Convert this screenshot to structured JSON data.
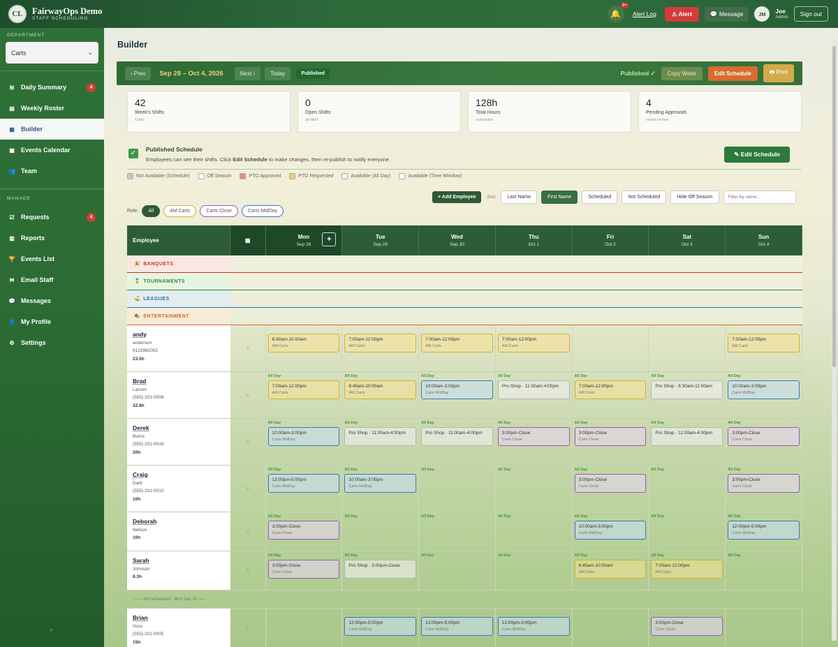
{
  "app": {
    "logo": "CL",
    "title": "FairwayOps Demo",
    "subtitle": "STAFF SCHEDULING"
  },
  "topbar": {
    "bell_badge": "9+",
    "alert_log": "Alert Log",
    "alert": "Alert",
    "message": "Message",
    "user_initials": "JM",
    "user_name": "Joe",
    "user_role": "Admin",
    "sign_out": "Sign out"
  },
  "sidebar": {
    "department_label": "DEPARTMENT",
    "department_value": "Carts",
    "manage_label": "MANAGE",
    "items": [
      {
        "label": "Daily Summary",
        "icon": "grid-icon",
        "badge": "4"
      },
      {
        "label": "Weekly Roster",
        "icon": "clipboard-icon",
        "badge": ""
      },
      {
        "label": "Builder",
        "icon": "calendar-icon",
        "badge": ""
      },
      {
        "label": "Events Calendar",
        "icon": "calendar-icon",
        "badge": ""
      },
      {
        "label": "Team",
        "icon": "team-icon",
        "badge": ""
      }
    ],
    "manage_items": [
      {
        "label": "Requests",
        "icon": "check-icon",
        "badge": "4"
      },
      {
        "label": "Reports",
        "icon": "chart-icon",
        "badge": ""
      },
      {
        "label": "Events List",
        "icon": "trophy-icon",
        "badge": ""
      },
      {
        "label": "Email Staff",
        "icon": "mail-icon",
        "badge": ""
      },
      {
        "label": "Messages",
        "icon": "chat-icon",
        "badge": ""
      },
      {
        "label": "My Profile",
        "icon": "user-icon",
        "badge": ""
      },
      {
        "label": "Settings",
        "icon": "gear-icon",
        "badge": ""
      }
    ]
  },
  "page": {
    "title": "Builder"
  },
  "toolbar": {
    "prev": "‹ Prev",
    "date_range": "Sep 28 – Oct 4, 2026",
    "next": "Next ›",
    "today": "Today",
    "published_pill": "Published",
    "published_status": "Published ✓",
    "copy_week": "Copy Week",
    "edit_schedule": "Edit Schedule",
    "print": "Print"
  },
  "stats": [
    {
      "value": "42",
      "label": "Week's Shifts",
      "sub": "Carts"
    },
    {
      "value": "0",
      "label": "Open Shifts",
      "sub": "all filled"
    },
    {
      "value": "128h",
      "label": "Total Hours",
      "sub": "scheduled"
    },
    {
      "value": "4",
      "label": "Pending Approvals",
      "sub": "needs review"
    }
  ],
  "publish_notice": {
    "title": "Published Schedule",
    "desc_pre": "Employees can see their shifts. Click ",
    "desc_bold": "Edit Schedule",
    "desc_post": " to make changes, then re-publish to notify everyone.",
    "button": "Edit Schedule"
  },
  "legend": [
    {
      "label": "Not Available (Schedule)",
      "color": "#c8c8c8"
    },
    {
      "label": "Off Season",
      "color": "#ffffff"
    },
    {
      "label": "PTO Approved",
      "color": "#e88a8a"
    },
    {
      "label": "PTO Requested",
      "color": "#f0c870"
    },
    {
      "label": "Available (All Day)",
      "color": "#f4f4f4"
    },
    {
      "label": "Available (Time Window)",
      "color": "#ffffff"
    }
  ],
  "controls": {
    "add_employee": "+ Add Employee",
    "sort_label": "Sort:",
    "last_name": "Last Name",
    "first_name": "First Name",
    "scheduled": "Scheduled",
    "not_scheduled": "Not Scheduled",
    "hide_off_season": "Hide Off Season",
    "filter_placeholder": "Filter by name..."
  },
  "roles": {
    "label": "Role:",
    "items": [
      "All",
      "AM Carts",
      "Carts Close",
      "Carts MidDay"
    ]
  },
  "grid": {
    "employee_header": "Employee",
    "days": [
      {
        "day": "Mon",
        "date": "Sep 28"
      },
      {
        "day": "Tue",
        "date": "Sep 29"
      },
      {
        "day": "Wed",
        "date": "Sep 30"
      },
      {
        "day": "Thu",
        "date": "Oct 1"
      },
      {
        "day": "Fri",
        "date": "Oct 2"
      },
      {
        "day": "Sat",
        "date": "Oct 3"
      },
      {
        "day": "Sun",
        "date": "Oct 4"
      }
    ],
    "categories": [
      {
        "label": "BANQUETS",
        "color": "#c0392b"
      },
      {
        "label": "TOURNAMENTS",
        "color": "#2e8b3a"
      },
      {
        "label": "LEAGUES",
        "color": "#2d6fa8"
      },
      {
        "label": "ENTERTAINMENT",
        "color": "#d06a2a"
      }
    ],
    "all_day": "All Day",
    "not_scheduled_sep": "—— Not scheduled · Mon Sep 28 ——"
  },
  "employees": [
    {
      "first": "andy",
      "last": "anderson",
      "phone": "6122982002",
      "hours": "23.5h",
      "allday": [
        0,
        0,
        0,
        0,
        0,
        0,
        0
      ],
      "shifts": [
        [
          "6:30am-10:00am",
          "AM Carts",
          "am"
        ],
        [
          "7:00am-12:00pm",
          "AM Carts",
          "am"
        ],
        [
          "7:00am-12:00pm",
          "AM Carts",
          "am"
        ],
        [
          "7:00am-12:00pm",
          "AM Carts",
          "am"
        ],
        null,
        null,
        [
          "7:00am-12:00pm",
          "AM Carts",
          "am"
        ]
      ]
    },
    {
      "first": "Brad",
      "last": "Larson",
      "phone": "(555) 201-0006",
      "hours": "32.8h",
      "allday": [
        1,
        1,
        1,
        1,
        1,
        1,
        1
      ],
      "shifts": [
        [
          "7:00am-12:00pm",
          "AM Carts",
          "am"
        ],
        [
          "6:45am-10:00am",
          "AM Carts",
          "am"
        ],
        [
          "10:00am-3:00pm",
          "Carts MidDay",
          "mid"
        ],
        [
          "Pro Shop · 11:00am-4:00pm",
          "",
          "pro"
        ],
        [
          "7:00am-12:00pm",
          "AM Carts",
          "am"
        ],
        [
          "Pro Shop · 6:30am-11:00am",
          "",
          "pro"
        ],
        [
          "10:00am-3:00pm",
          "Carts MidDay",
          "mid"
        ]
      ]
    },
    {
      "first": "Derek",
      "last": "Burns",
      "phone": "(555) 201-0018",
      "hours": "20h",
      "allday": [
        1,
        1,
        1,
        1,
        1,
        1,
        1
      ],
      "shifts": [
        [
          "10:00am-3:00pm",
          "Carts MidDay",
          "mid"
        ],
        [
          "Pro Shop · 11:00am-4:00pm",
          "",
          "pro"
        ],
        [
          "Pro Shop · 11:00am-4:00pm",
          "",
          "pro"
        ],
        [
          "3:00pm-Close",
          "Carts Close",
          "close"
        ],
        [
          "3:00pm-Close",
          "Carts Close",
          "close"
        ],
        [
          "Pro Shop · 11:00am-4:00pm",
          "",
          "pro"
        ],
        [
          "3:00pm-Close",
          "Carts Close",
          "close"
        ]
      ]
    },
    {
      "first": "Craig",
      "last": "Dahl",
      "phone": "(555) 201-0010",
      "hours": "10h",
      "allday": [
        1,
        1,
        1,
        1,
        1,
        1,
        1
      ],
      "shifts": [
        [
          "12:00pm-5:00pm",
          "Carts MidDay",
          "mid"
        ],
        [
          "10:00am-3:00pm",
          "Carts MidDay",
          "mid"
        ],
        null,
        null,
        [
          "3:00pm-Close",
          "Carts Close",
          "close"
        ],
        null,
        [
          "3:00pm-Close",
          "Carts Close",
          "close"
        ]
      ]
    },
    {
      "first": "Deborah",
      "last": "Nelson",
      "phone": "",
      "hours": "10h",
      "allday": [
        1,
        1,
        1,
        1,
        1,
        1,
        1
      ],
      "shifts": [
        [
          "3:00pm-Close",
          "Carts Close",
          "close"
        ],
        null,
        null,
        null,
        [
          "10:00am-3:00pm",
          "Carts MidDay",
          "mid"
        ],
        null,
        [
          "12:00pm-5:00pm",
          "Carts MidDay",
          "mid"
        ]
      ]
    },
    {
      "first": "Sarah",
      "last": "Johnson",
      "phone": "",
      "hours": "8.3h",
      "allday": [
        1,
        1,
        1,
        1,
        1,
        1,
        1
      ],
      "shifts": [
        [
          "3:00pm-Close",
          "Carts Close",
          "close"
        ],
        [
          "Pro Shop · 3:00pm-Close",
          "",
          "pro"
        ],
        null,
        null,
        [
          "6:45am-10:00am",
          "AM Carts",
          "am"
        ],
        [
          "7:00am-12:00pm",
          "AM Carts",
          "am"
        ],
        null
      ]
    },
    {
      "first": "Brian",
      "last": "Voss",
      "phone": "(555) 201-0005",
      "hours": "15h",
      "allday": [
        0,
        0,
        0,
        0,
        0,
        0,
        0
      ],
      "shifts": [
        null,
        [
          "12:00pm-5:00pm",
          "Carts MidDay",
          "mid"
        ],
        [
          "12:00pm-5:00pm",
          "Carts MidDay",
          "mid"
        ],
        [
          "12:00pm-5:00pm",
          "Carts MidDay",
          "mid"
        ],
        null,
        [
          "3:00pm-Close",
          "Carts Close",
          "close"
        ],
        null
      ]
    }
  ],
  "shift_styles": {
    "am": {
      "border": "#d9b02c",
      "bg": "rgba(246,226,150,0.55)"
    },
    "mid": {
      "border": "#3a78c0",
      "bg": "rgba(200,222,245,0.55)"
    },
    "close": {
      "border": "#9a5cc0",
      "bg": "rgba(233,214,245,0.55)"
    },
    "pro": {
      "border": "#b5b5b5",
      "bg": "rgba(240,240,240,0.6)"
    }
  },
  "colors": {
    "accent": "#2e5a36",
    "primary_green": "#2c5d36",
    "alert_red": "#d43b3b",
    "edit_orange": "#d86c2e"
  }
}
